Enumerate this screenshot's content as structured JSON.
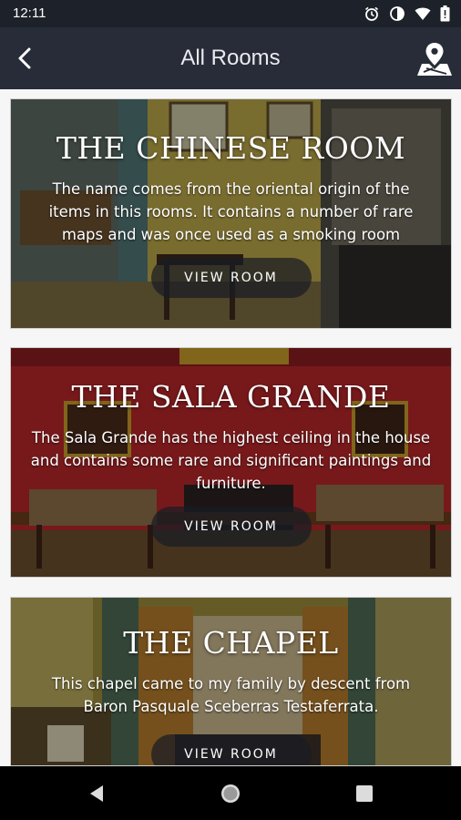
{
  "status": {
    "time": "12:11",
    "icons": [
      "alarm-icon",
      "vibrate-icon",
      "wifi-icon",
      "battery-icon"
    ]
  },
  "appbar": {
    "title": "All Rooms",
    "back_icon": "chevron-left-icon",
    "map_icon": "map-pin-icon"
  },
  "rooms": [
    {
      "title": "THE CHINESE ROOM",
      "description": "The name comes from the oriental origin of the items in this rooms. It contains a number of rare maps and was once used as a smoking room",
      "button": "VIEW ROOM"
    },
    {
      "title": "THE SALA GRANDE",
      "description": "The Sala Grande has the highest ceiling in the house and contains some rare and significant paintings and furniture.",
      "button": "VIEW ROOM"
    },
    {
      "title": "THE CHAPEL",
      "description": "This chapel came to my family by descent from Baron Pasquale Sceberras Testaferrata.",
      "button": "VIEW ROOM"
    }
  ],
  "colors": {
    "appbar": "#272c38",
    "statusbar": "#1d2129",
    "card_shade": "rgba(0,0,0,0.34)"
  }
}
